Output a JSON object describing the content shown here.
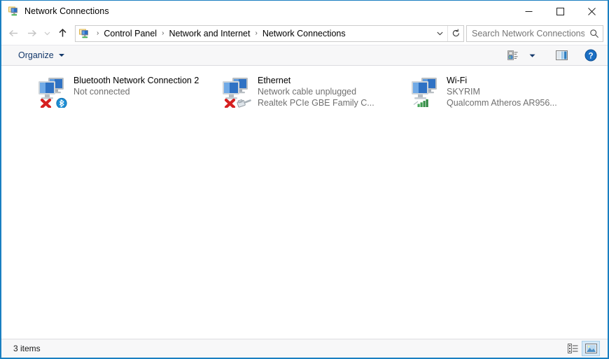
{
  "window": {
    "title": "Network Connections",
    "title_icon": "network-connections-icon",
    "accent_border": "#1a7fc1",
    "controls": {
      "minimize": "minimize-button",
      "maximize": "maximize-button",
      "close": "close-button"
    }
  },
  "nav": {
    "back": "back-button",
    "forward": "forward-button",
    "recent": "recent-locations-button",
    "up": "up-button",
    "address_icon": "network-connections-icon",
    "breadcrumbs": [
      "Control Panel",
      "Network and Internet",
      "Network Connections"
    ],
    "separator": "›",
    "dropdown": "address-dropdown-icon",
    "refresh": "refresh-icon"
  },
  "search": {
    "placeholder": "Search Network Connections",
    "value": "",
    "icon": "search-icon"
  },
  "toolbar": {
    "organize_label": "Organize",
    "view_options": "view-options-icon",
    "view_options_caret": "chevron-down-icon",
    "preview_pane": "preview-pane-icon",
    "help": "help-icon"
  },
  "connections": [
    {
      "name": "Bluetooth Network Connection 2",
      "status": "Not connected",
      "adapter": "",
      "icon": "network-adapter-icon",
      "badge": "bluetooth-badge",
      "disconnected": true
    },
    {
      "name": "Ethernet",
      "status": "Network cable unplugged",
      "adapter": "Realtek PCIe GBE Family C...",
      "icon": "network-adapter-icon",
      "badge": "ethernet-cable-badge",
      "disconnected": true
    },
    {
      "name": "Wi-Fi",
      "status": "SKYRIM",
      "adapter": "Qualcomm Atheros AR956...",
      "icon": "network-adapter-icon",
      "badge": "wifi-signal-badge",
      "disconnected": false
    }
  ],
  "status": {
    "items_text": "3 items",
    "details_view": "details-view-button",
    "large_icons_view": "large-icons-view-button"
  },
  "colors": {
    "accent": "#1a7fc1",
    "link": "#13386b",
    "muted_text": "#707070",
    "toolbar_bg": "#f7f7f8",
    "badge_bluetooth": "#1e8fd5",
    "badge_wifi": "#3f9c50",
    "error_x": "#d62020"
  }
}
